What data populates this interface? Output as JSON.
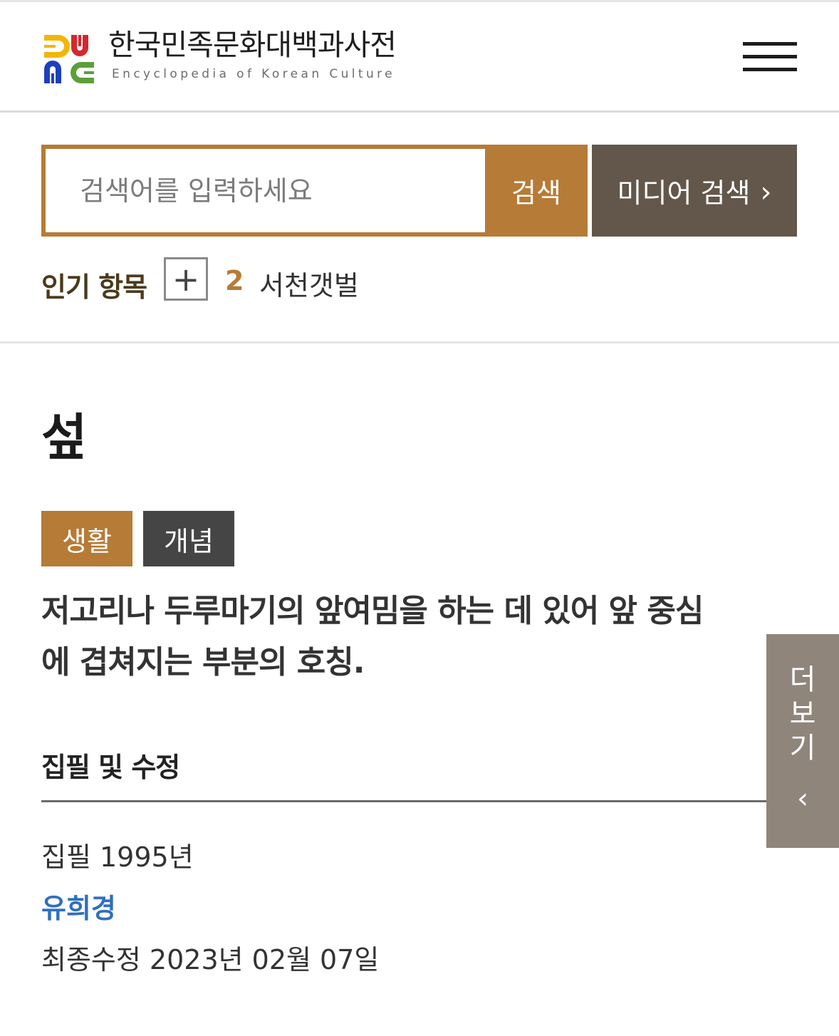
{
  "header": {
    "title": "한국민족문화대백과사전",
    "subtitle": "Encyclopedia of Korean Culture",
    "logo_icon": "aks-logo-icon",
    "menu_icon": "hamburger-menu-icon"
  },
  "search": {
    "placeholder": "검색어를 입력하세요",
    "value": "",
    "button_label": "검색",
    "media_button_label": "미디어 검색",
    "media_chevron": "›"
  },
  "popular": {
    "label": "인기 항목",
    "expand_symbol": "+",
    "rank": "2",
    "term": "서천갯벌"
  },
  "article": {
    "title": "섶",
    "tags": [
      "생활",
      "개념"
    ],
    "summary": "저고리나 두루마기의 앞여밈을 하는 데 있어 앞 중심에 겹쳐지는 부분의 호칭.",
    "section_heading": "집필 및 수정",
    "written": "집필 1995년",
    "author": "유희경",
    "modified": "최종수정 2023년 02월 07일"
  },
  "side_tab": {
    "label": "더보기",
    "chevron": "‹"
  },
  "colors": {
    "accent": "#b67b36",
    "media_button": "#62574a",
    "tag_dark": "#454545",
    "author_link": "#2f6fc0",
    "side_tab": "#8f857b"
  }
}
